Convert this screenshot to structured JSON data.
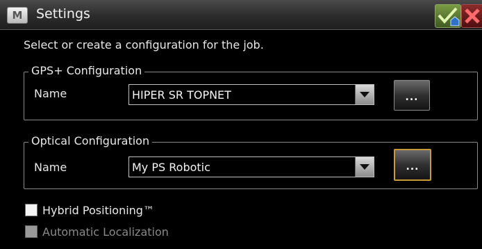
{
  "titlebar": {
    "title": "Settings",
    "app_icon_glyph": "M",
    "accept_icon": "check-home-icon",
    "cancel_icon": "close-x-icon"
  },
  "instruction": "Select or create a configuration for the job.",
  "gps_group": {
    "legend": "GPS+ Configuration",
    "name_label": "Name",
    "selected_value": "HIPER SR TOPNET",
    "browse_label": "..."
  },
  "optical_group": {
    "legend": "Optical Configuration",
    "name_label": "Name",
    "selected_value": "My PS Robotic",
    "browse_label": "..."
  },
  "options": {
    "hybrid_label": "Hybrid Positioning™",
    "hybrid_checked": false,
    "auto_label": "Automatic Localization",
    "auto_checked": false,
    "auto_enabled": false
  },
  "colors": {
    "background": "#000000",
    "accent_green": "#4f7a2a",
    "cancel_red": "#8a1f1f",
    "focus_border": "#c89a3a"
  }
}
